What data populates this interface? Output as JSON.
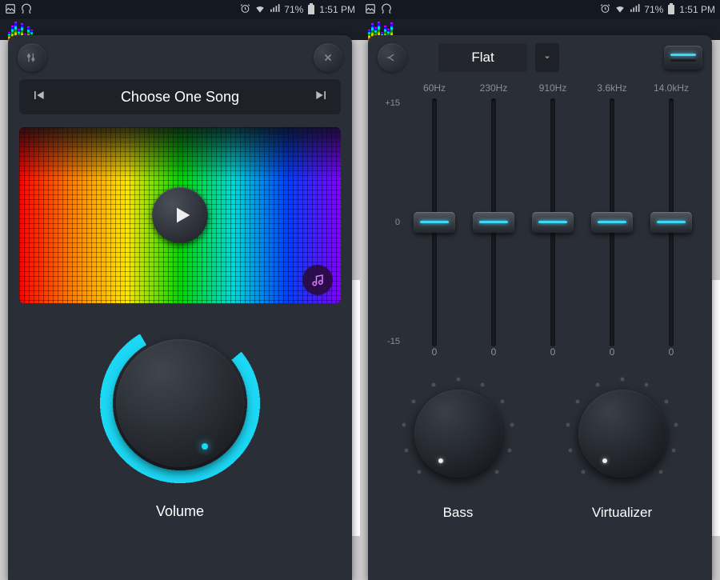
{
  "status": {
    "battery": "71%",
    "time": "1:51 PM"
  },
  "left": {
    "track_title": "Choose One Song",
    "volume_label": "Volume"
  },
  "right": {
    "preset": "Flat",
    "scale": {
      "top": "+15",
      "mid": "0",
      "bot": "-15"
    },
    "freqs": [
      "60Hz",
      "230Hz",
      "910Hz",
      "3.6kHz",
      "14.0kHz"
    ],
    "values": [
      "0",
      "0",
      "0",
      "0",
      "0"
    ],
    "bass_label": "Bass",
    "virt_label": "Virtualizer"
  }
}
